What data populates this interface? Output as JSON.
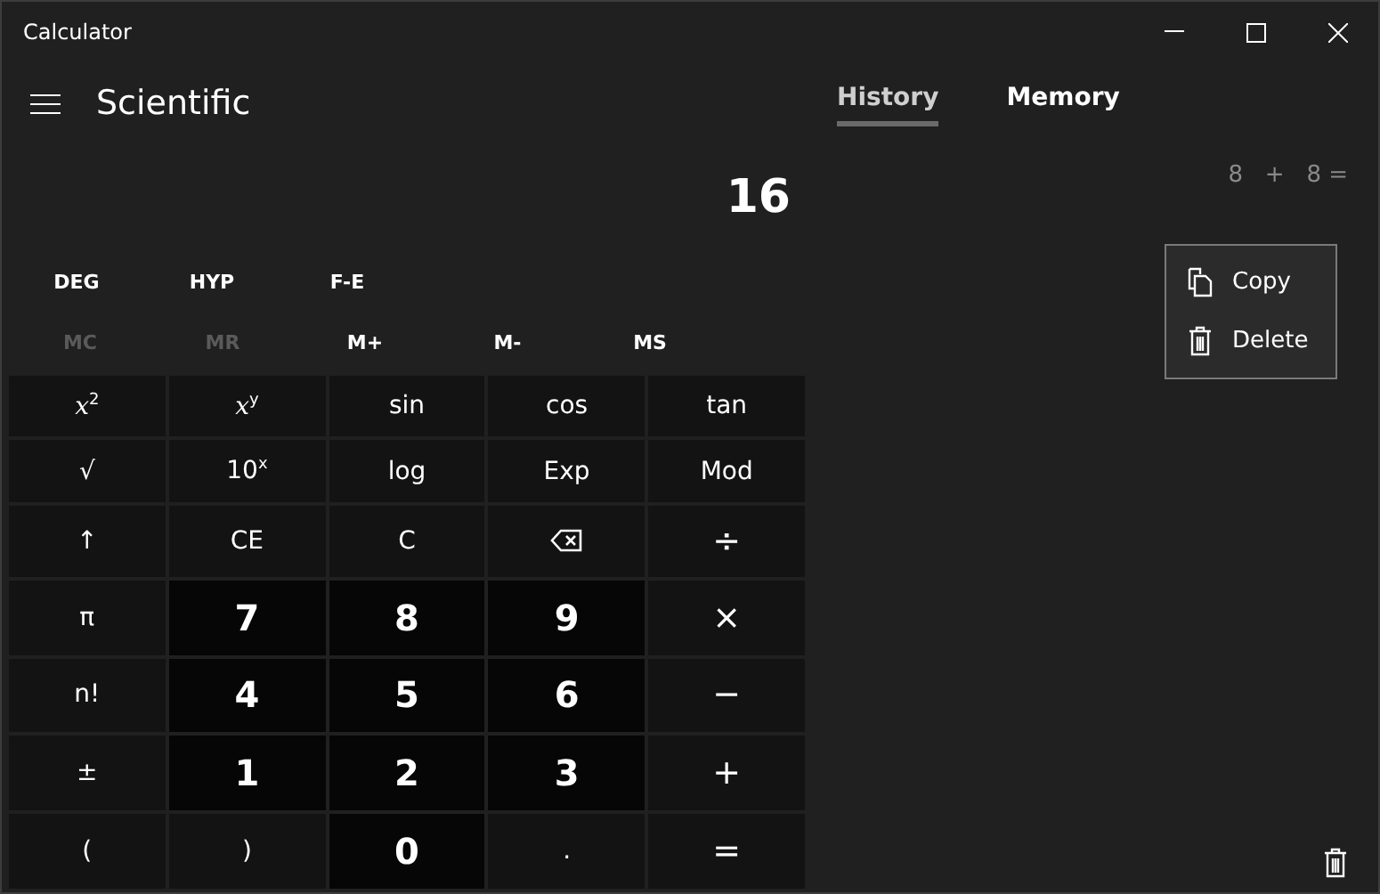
{
  "window": {
    "title": "Calculator"
  },
  "mode": "Scientific",
  "display": "16",
  "angle_options": [
    {
      "label": "DEG",
      "disabled": false
    },
    {
      "label": "HYP",
      "disabled": false
    },
    {
      "label": "F-E",
      "disabled": false
    }
  ],
  "memory_buttons": [
    {
      "label": "MC",
      "disabled": true
    },
    {
      "label": "MR",
      "disabled": true
    },
    {
      "label": "M+",
      "disabled": false
    },
    {
      "label": "M-",
      "disabled": false
    },
    {
      "label": "MS",
      "disabled": false
    }
  ],
  "keys": [
    {
      "label": "*x*$^{2}$",
      "kind": "fn"
    },
    {
      "label": "*x*$^{y}$",
      "kind": "fn"
    },
    {
      "label": "sin",
      "kind": "fn"
    },
    {
      "label": "cos",
      "kind": "fn"
    },
    {
      "label": "tan",
      "kind": "fn"
    },
    {
      "label": "√",
      "kind": "fn"
    },
    {
      "label": "10$^{x}$",
      "kind": "fn"
    },
    {
      "label": "log",
      "kind": "fn"
    },
    {
      "label": "Exp",
      "kind": "fn"
    },
    {
      "label": "Mod",
      "kind": "fn"
    },
    {
      "label": "↑",
      "kind": "fn"
    },
    {
      "label": "CE",
      "kind": "fn"
    },
    {
      "label": "C",
      "kind": "fn"
    },
    {
      "kind": "backspace"
    },
    {
      "label": "÷",
      "kind": "op"
    },
    {
      "label": "π",
      "kind": "fn"
    },
    {
      "label": "7",
      "kind": "digit"
    },
    {
      "label": "8",
      "kind": "digit"
    },
    {
      "label": "9",
      "kind": "digit"
    },
    {
      "label": "×",
      "kind": "op"
    },
    {
      "label": "n!",
      "kind": "fn"
    },
    {
      "label": "4",
      "kind": "digit"
    },
    {
      "label": "5",
      "kind": "digit"
    },
    {
      "label": "6",
      "kind": "digit"
    },
    {
      "label": "−",
      "kind": "op"
    },
    {
      "label": "±",
      "kind": "fn"
    },
    {
      "label": "1",
      "kind": "digit"
    },
    {
      "label": "2",
      "kind": "digit"
    },
    {
      "label": "3",
      "kind": "digit"
    },
    {
      "label": "+",
      "kind": "op"
    },
    {
      "label": "(",
      "kind": "fn"
    },
    {
      "label": ")",
      "kind": "fn"
    },
    {
      "label": "0",
      "kind": "digit"
    },
    {
      "label": ".",
      "kind": "fn"
    },
    {
      "label": "=",
      "kind": "op"
    }
  ],
  "panel_tabs": [
    {
      "label": "History",
      "selected": true
    },
    {
      "label": "Memory",
      "selected": false
    }
  ],
  "history": [
    {
      "expression": "8   +   8 ="
    }
  ],
  "context_menu": [
    {
      "label": "Copy",
      "kind": "copy"
    },
    {
      "label": "Delete",
      "kind": "delete"
    }
  ]
}
